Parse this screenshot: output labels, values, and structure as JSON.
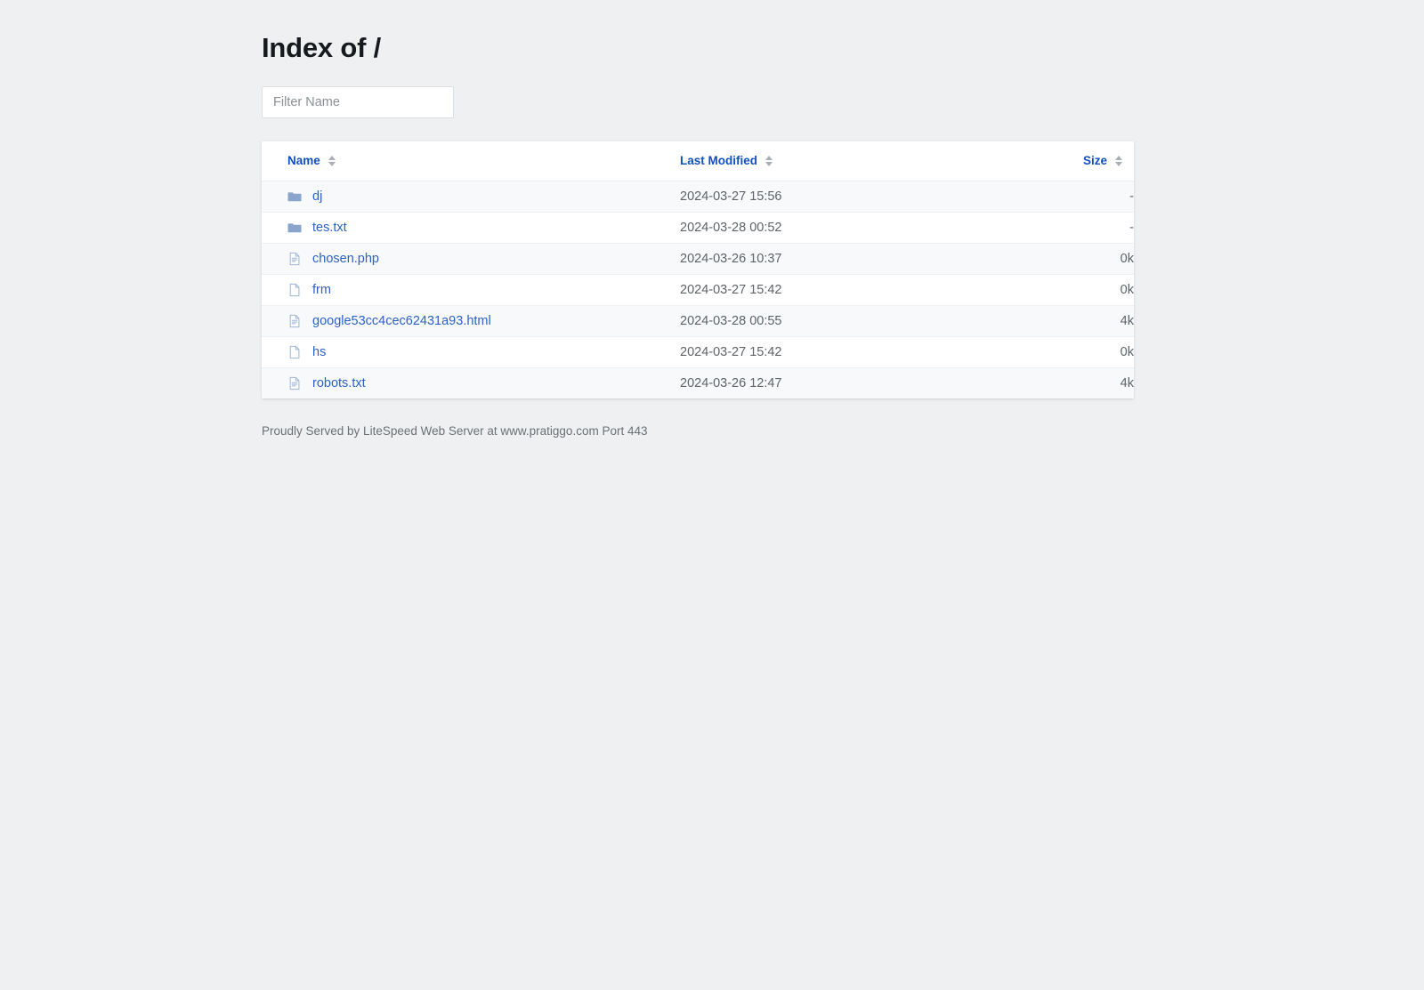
{
  "page": {
    "title": "Index of /",
    "footer": "Proudly Served by LiteSpeed Web Server at www.pratiggo.com Port 443"
  },
  "filter": {
    "placeholder": "Filter Name",
    "value": ""
  },
  "table": {
    "columns": [
      {
        "key": "name",
        "label": "Name",
        "sort_icon": "sort-updown-icon"
      },
      {
        "key": "modified",
        "label": "Last Modified",
        "sort_icon": "sort-updown-icon"
      },
      {
        "key": "size",
        "label": "Size",
        "sort_icon": "sort-updown-icon"
      }
    ],
    "rows": [
      {
        "icon": "folder-icon",
        "name": "dj",
        "modified": "2024-03-27 15:56",
        "size": "-"
      },
      {
        "icon": "folder-icon",
        "name": "tes.txt",
        "modified": "2024-03-28 00:52",
        "size": "-"
      },
      {
        "icon": "file-text-icon",
        "name": "chosen.php",
        "modified": "2024-03-26 10:37",
        "size": "0k"
      },
      {
        "icon": "file-blank-icon",
        "name": "frm",
        "modified": "2024-03-27 15:42",
        "size": "0k"
      },
      {
        "icon": "file-text-icon",
        "name": "google53cc4cec62431a93.html",
        "modified": "2024-03-28 00:55",
        "size": "4k"
      },
      {
        "icon": "file-blank-icon",
        "name": "hs",
        "modified": "2024-03-27 15:42",
        "size": "0k"
      },
      {
        "icon": "file-text-icon",
        "name": "robots.txt",
        "modified": "2024-03-26 12:47",
        "size": "4k"
      }
    ]
  },
  "colors": {
    "page_background": "#eff0f2",
    "header_link": "#1250bf",
    "row_link": "#2c62c6",
    "row_stripe": "#f8f9fa",
    "icon_blue": "#8ba4cc",
    "text_muted": "#5d6368"
  }
}
